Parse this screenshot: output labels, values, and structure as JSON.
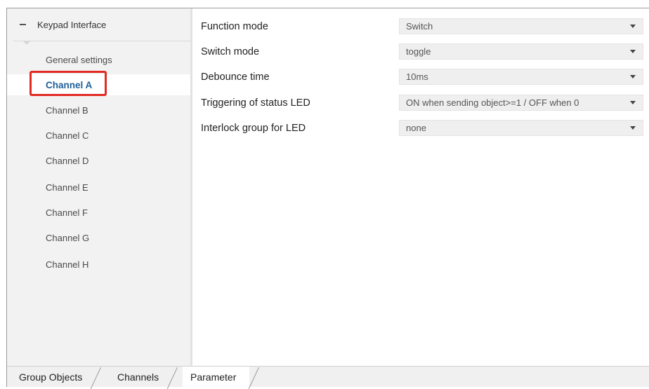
{
  "sidebar": {
    "root_label": "Keypad Interface",
    "items": [
      {
        "label": "General settings",
        "selected": false
      },
      {
        "label": "Channel A",
        "selected": true
      },
      {
        "label": "Channel B",
        "selected": false
      },
      {
        "label": "Channel C",
        "selected": false
      },
      {
        "label": "Channel D",
        "selected": false
      },
      {
        "label": "Channel E",
        "selected": false
      },
      {
        "label": "Channel F",
        "selected": false
      },
      {
        "label": "Channel G",
        "selected": false
      },
      {
        "label": "Channel H",
        "selected": false
      }
    ]
  },
  "parameters": [
    {
      "label": "Function mode",
      "value": "Switch"
    },
    {
      "label": "Switch mode",
      "value": "toggle"
    },
    {
      "label": "Debounce time",
      "value": "10ms"
    },
    {
      "label": "Triggering of status LED",
      "value": "ON when sending object>=1 / OFF when 0"
    },
    {
      "label": "Interlock group for LED",
      "value": "none"
    }
  ],
  "tabs": [
    {
      "label": "Group Objects",
      "active": false
    },
    {
      "label": "Channels",
      "active": false
    },
    {
      "label": "Parameter",
      "active": true
    }
  ],
  "colors": {
    "selected_text": "#1f5f99",
    "highlight": "#e02a22",
    "sidebar_bg": "#f2f2f2"
  }
}
